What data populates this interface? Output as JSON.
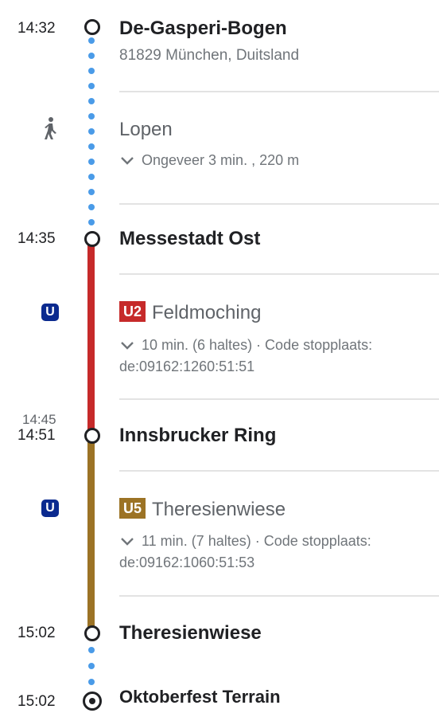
{
  "colors": {
    "walk_dots": "#4a9be8",
    "u2": "#c62a2a",
    "u5": "#9c7325",
    "ubahn_icon": "#0b2a8f"
  },
  "origin": {
    "time": "14:32",
    "name": "De-Gasperi-Bogen",
    "address": "81829 München, Duitsland"
  },
  "walk": {
    "icon": "walking-person-icon",
    "mode": "Lopen",
    "summary": "Ongeveer 3 min. , 220 m"
  },
  "stop1": {
    "time": "14:35",
    "name": "Messestadt Ost"
  },
  "leg1": {
    "icon": "ubahn-icon",
    "icon_label": "U",
    "line": "U2",
    "destination": "Feldmoching",
    "detail_line1": "10 min. (6 haltes) · Code stopplaats:",
    "detail_line2": "de:09162:1260:51:51"
  },
  "stop2": {
    "arrival_time": "14:45",
    "departure_time": "14:51",
    "name": "Innsbrucker Ring"
  },
  "leg2": {
    "icon": "ubahn-icon",
    "icon_label": "U",
    "line": "U5",
    "destination": "Theresienwiese",
    "detail_line1": "11 min. (7 haltes) · Code stopplaats:",
    "detail_line2": "de:09162:1060:51:53"
  },
  "stop3": {
    "time": "15:02",
    "name": "Theresienwiese"
  },
  "destination": {
    "time": "15:02",
    "name": "Oktoberfest Terrain"
  }
}
